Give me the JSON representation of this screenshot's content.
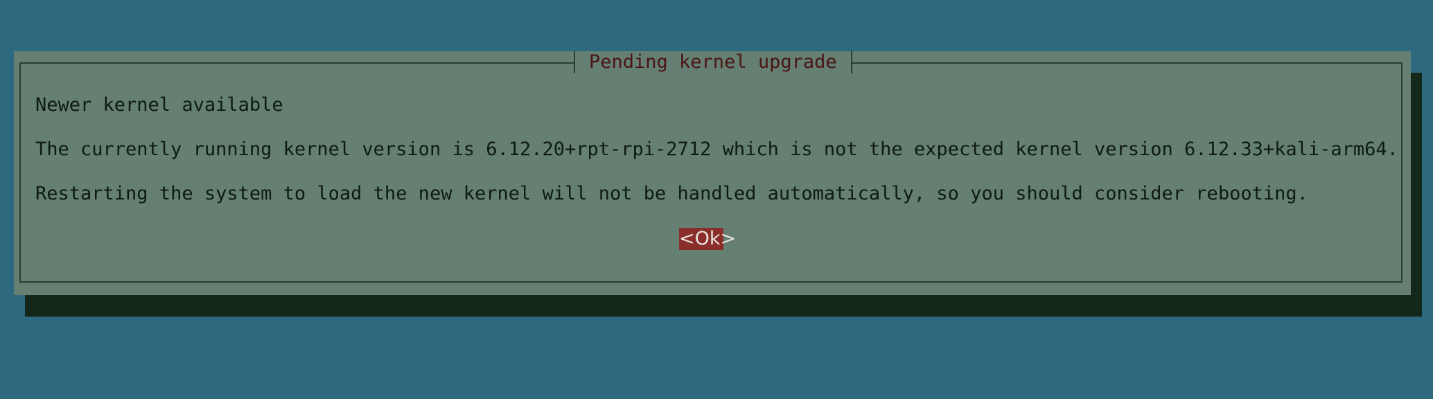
{
  "dialog": {
    "title": "Pending kernel upgrade",
    "heading": "Newer kernel available",
    "message_line1": "The currently running kernel version is 6.12.20+rpt-rpi-2712 which is not the expected kernel version 6.12.33+kali-arm64.",
    "message_line2": "Restarting the system to load the new kernel will not be handled automatically, so you should consider rebooting.",
    "ok_label": "<Ok>"
  },
  "colors": {
    "background": "#2e6a7f",
    "dialog": "#657f72",
    "shadow": "#132818",
    "title_text": "#4a1414",
    "button": "#8b2e2b"
  }
}
